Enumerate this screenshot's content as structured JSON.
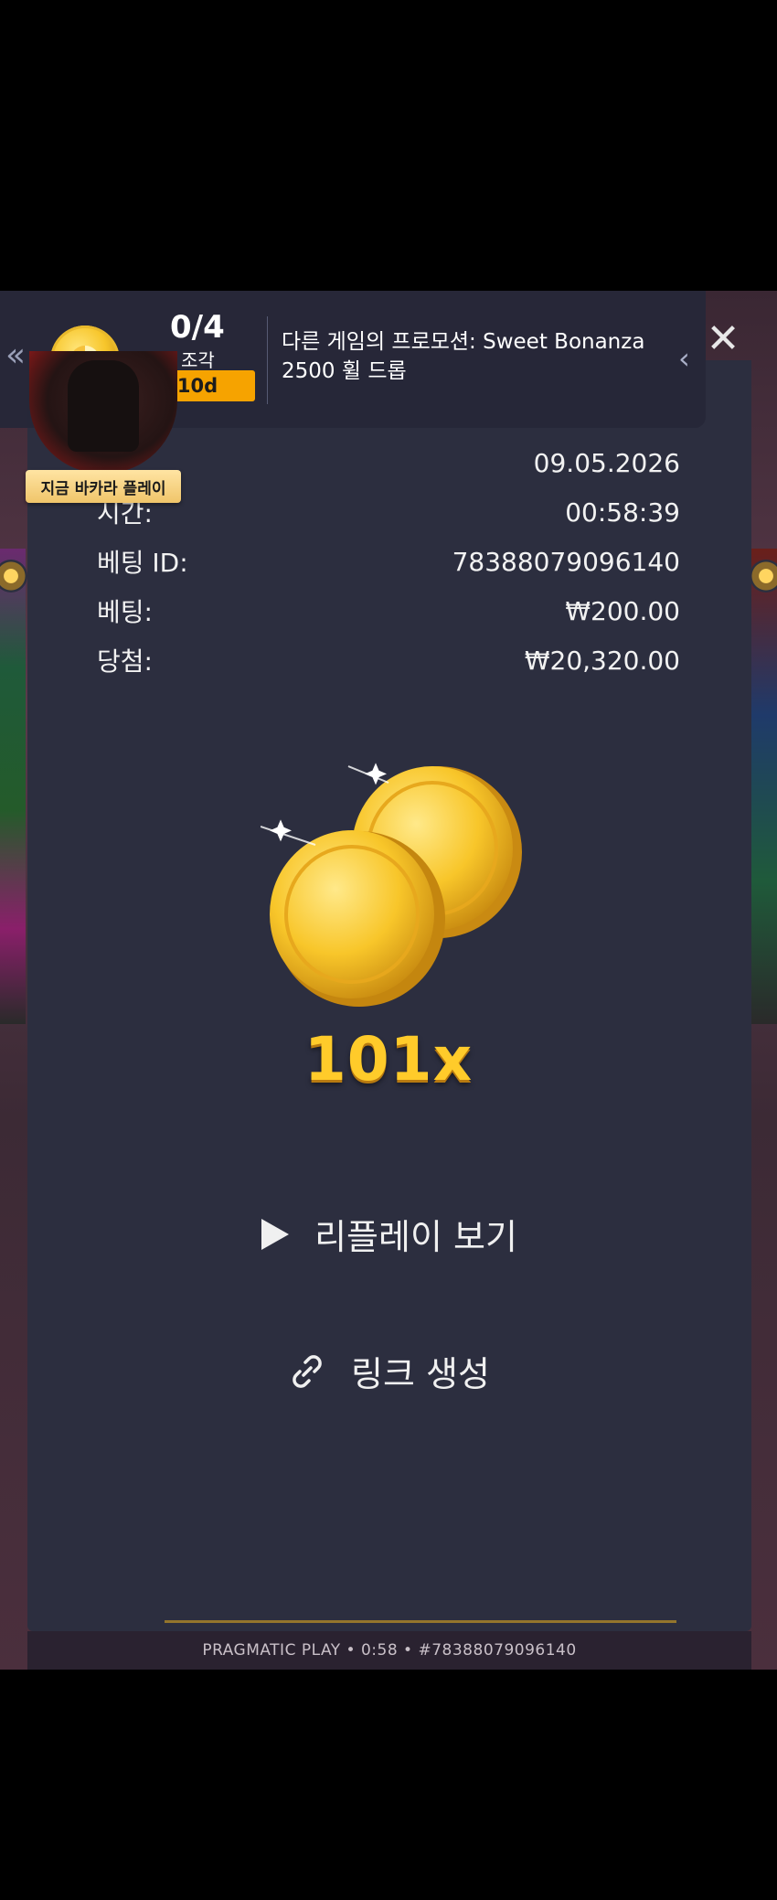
{
  "promo": {
    "count": "0/4",
    "pieces_label": "조각",
    "days_left": "10d",
    "message": "다른 게임의 프로모션: Sweet Bonanza 2500 휠 드롭"
  },
  "dealer": {
    "tag": "지금 바카라 플레이"
  },
  "bet_details": {
    "rows": [
      {
        "label": "",
        "value": "09.05.2026"
      },
      {
        "label": "시간:",
        "value": "00:58:39"
      },
      {
        "label": "베팅 ID:",
        "value": "78388079096140"
      },
      {
        "label": "베팅:",
        "value": "₩200.00"
      },
      {
        "label": "당첨:",
        "value": "₩20,320.00"
      }
    ]
  },
  "win": {
    "multiplier": "101x"
  },
  "actions": {
    "replay_label": "리플레이 보기",
    "link_label": "링크 생성"
  },
  "footer": {
    "text": "PRAGMATIC PLAY • 0:58 • #78388079096140"
  },
  "colors": {
    "modal_bg": "#2c2e3f",
    "accent_orange": "#f6a300",
    "coin_gold": "#ffcb2a"
  }
}
